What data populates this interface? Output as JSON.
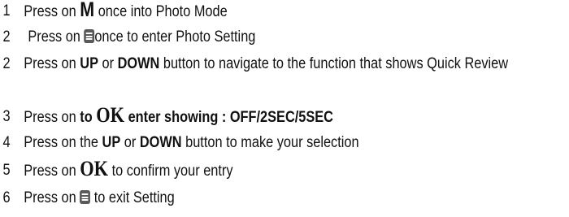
{
  "steps": [
    {
      "num": "1",
      "t1": "Press on ",
      "key": "M",
      "t2": " once into Photo Mode"
    },
    {
      "num": "2",
      "t1": "Press on ",
      "icon": "menu-icon",
      "t2": "once to enter Photo Setting"
    },
    {
      "num": "2",
      "t1": "Press on ",
      "b1": "UP",
      "t2": " or ",
      "b2": "DOWN",
      "t3": " button to navigate to the function that shows Quick Review"
    },
    {
      "num": "3",
      "t1": "Press on  ",
      "b1": "to ",
      "key": "OK",
      "b2": " enter showing : OFF/2SEC/5SEC"
    },
    {
      "num": "4",
      "t1": "Press on the ",
      "b1": "UP",
      "t2": " or ",
      "b2": "DOWN",
      "t3": " button to make your selection"
    },
    {
      "num": "5",
      "t1": "Press on ",
      "key": "OK",
      "t2": " to confirm your entry"
    },
    {
      "num": "6",
      "t1": "Press on ",
      "icon": "menu-icon",
      "t2": " to exit Setting"
    }
  ]
}
